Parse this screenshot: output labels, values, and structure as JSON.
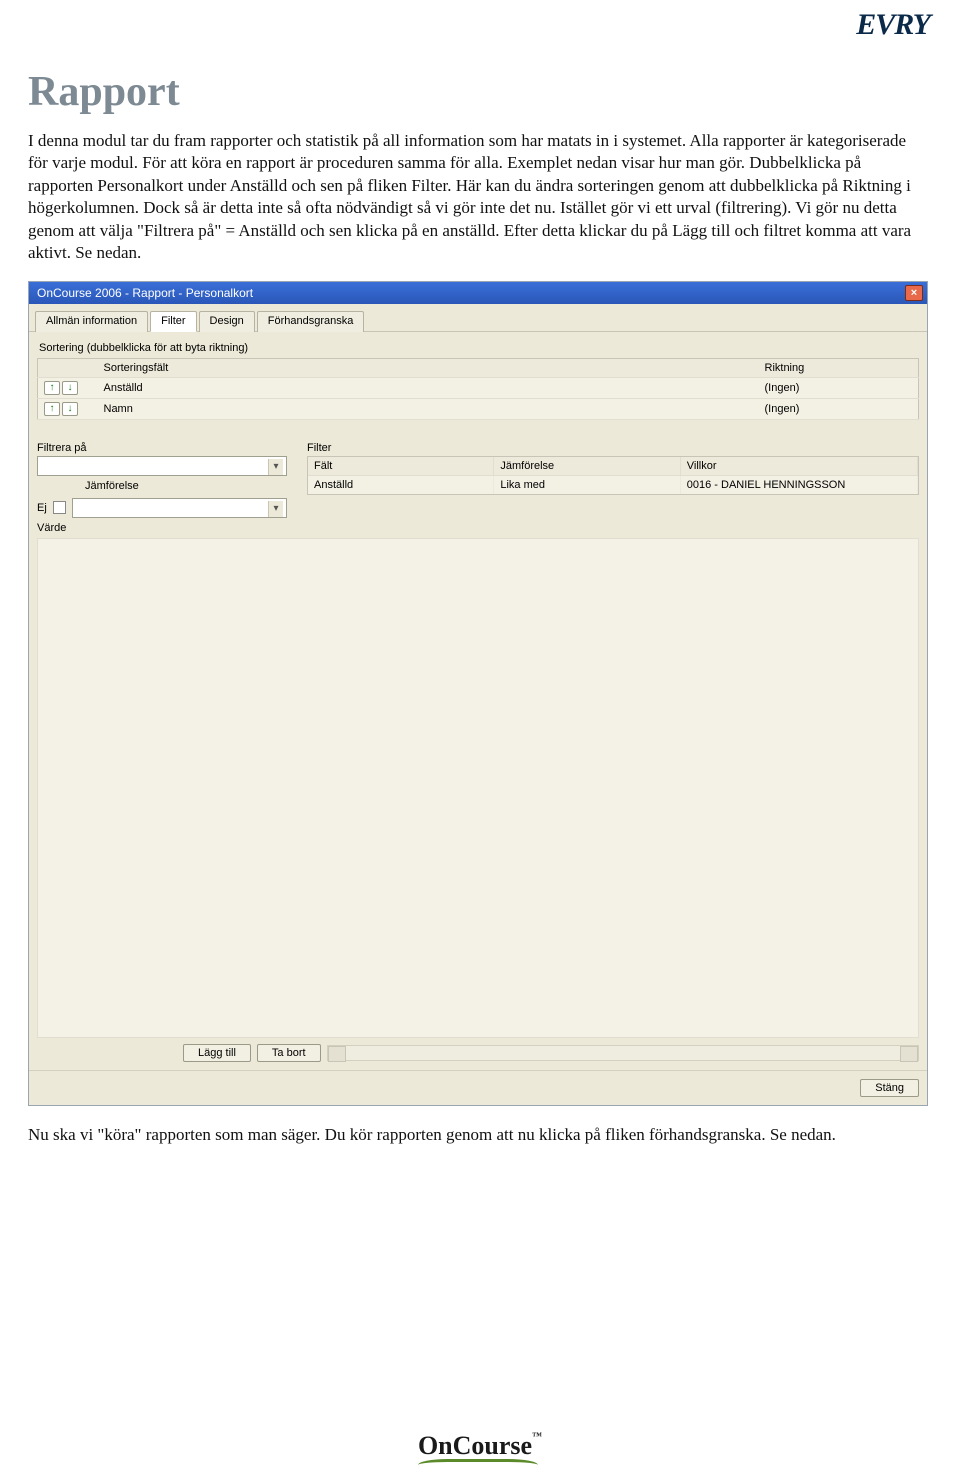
{
  "brand_top": "EVRY",
  "brand_bottom": "OnCourse",
  "doc": {
    "title": "Rapport",
    "para1": "I denna modul tar du fram rapporter och statistik på all information som har matats in i systemet. Alla rapporter är kategoriserade för varje modul. För att köra en rapport är proceduren samma för alla. Exemplet nedan visar hur man gör. Dubbelklicka på rapporten Personalkort under Anställd och sen på fliken Filter. Här kan du ändra sorteringen genom att dubbelklicka på Riktning i högerkolumnen. Dock så är detta inte så ofta nödvändigt så vi gör inte det nu. Istället gör vi ett urval (filtrering). Vi gör nu detta genom att välja \"Filtrera på\" = Anställd och sen klicka på en anställd. Efter detta klickar du på Lägg till och filtret komma att vara aktivt. Se nedan.",
    "para2": "Nu ska vi \"köra\" rapporten som man säger. Du kör rapporten genom att nu klicka på fliken förhandsgranska. Se nedan."
  },
  "win": {
    "title": "OnCourse 2006 - Rapport - Personalkort",
    "tabs": [
      "Allmän information",
      "Filter",
      "Design",
      "Förhandsgranska"
    ],
    "active_tab": "Filter",
    "sort_caption": "Sortering (dubbelklicka för att byta riktning)",
    "sort_headers": {
      "field": "Sorteringsfält",
      "dir": "Riktning"
    },
    "sort_rows": [
      {
        "field": "Anställd",
        "dir": "(Ingen)"
      },
      {
        "field": "Namn",
        "dir": "(Ingen)"
      }
    ],
    "left": {
      "filtrera_pa": "Filtrera på",
      "jamforelse": "Jämförelse",
      "ej": "Ej",
      "varde": "Värde"
    },
    "right": {
      "filter": "Filter",
      "headers": {
        "falt": "Fält",
        "jamforelse": "Jämförelse",
        "villkor": "Villkor"
      },
      "row": {
        "falt": "Anställd",
        "jamforelse": "Lika med",
        "villkor": "0016 - DANIEL HENNINGSSON"
      }
    },
    "buttons": {
      "lagg_till": "Lägg till",
      "ta_bort": "Ta bort",
      "stang": "Stäng"
    }
  }
}
